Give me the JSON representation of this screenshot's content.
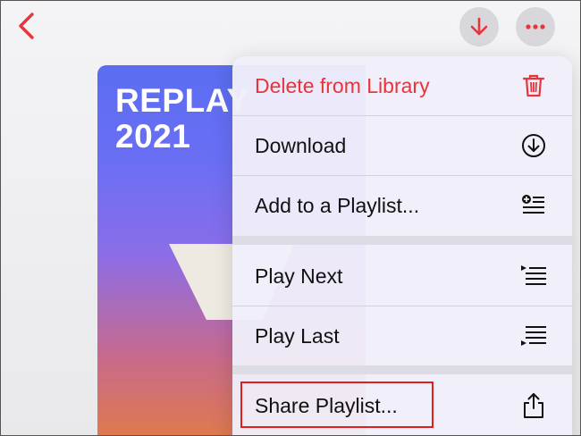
{
  "nav": {
    "back_icon": "chevron-left-icon",
    "download_icon": "arrow-down-icon",
    "more_icon": "ellipsis-icon",
    "accent_color": "#e8343a"
  },
  "album": {
    "title": "REPLAY\n2021"
  },
  "menu": {
    "items": [
      {
        "label": "Delete from Library",
        "icon": "trash-icon",
        "destructive": true
      },
      {
        "label": "Download",
        "icon": "download-circle-icon"
      },
      {
        "label": "Add to a Playlist...",
        "icon": "add-to-playlist-icon"
      },
      {
        "label": "Play Next",
        "icon": "play-next-icon"
      },
      {
        "label": "Play Last",
        "icon": "play-last-icon"
      },
      {
        "label": "Share Playlist...",
        "icon": "share-icon"
      }
    ]
  }
}
